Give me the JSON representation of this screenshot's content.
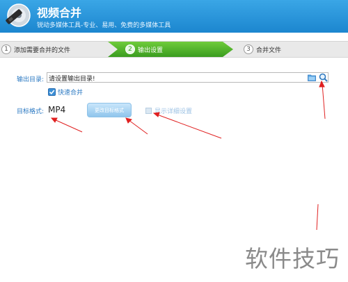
{
  "header": {
    "title": "视频合并",
    "subtitle": "锐动多媒体工具-专业、易用、免费的多媒体工具"
  },
  "steps": [
    {
      "number": "1",
      "label": "添加需要合并的文件"
    },
    {
      "number": "2",
      "label": "输出设置"
    },
    {
      "number": "3",
      "label": "合并文件"
    }
  ],
  "output": {
    "label": "输出目录:",
    "value": "请设置输出目录!"
  },
  "fast_merge": {
    "label": "快速合并",
    "checked": true
  },
  "target": {
    "label": "目标格式:",
    "format": "MP4",
    "change_button": "更改目标格式"
  },
  "detail_settings": {
    "label": "显示详细设置",
    "checked": false
  },
  "watermark": "软件技巧",
  "colors": {
    "header": "#1c86cf",
    "active_step": "#46ad22",
    "label_blue": "#2a78c2",
    "arrow": "#e02020"
  }
}
